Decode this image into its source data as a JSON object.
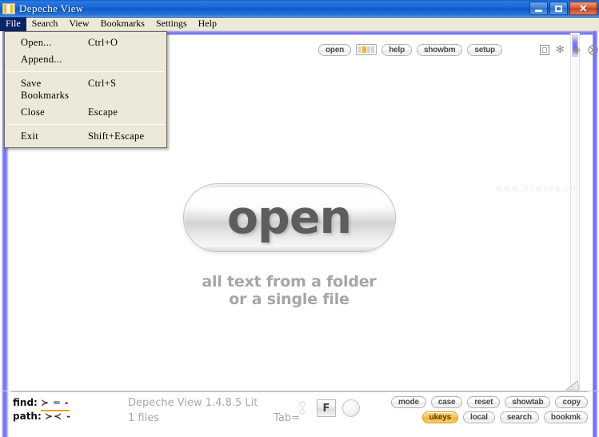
{
  "window": {
    "title": "Depeche View",
    "app_icon": "bars-icon",
    "controls": {
      "minimize": "minimize-icon",
      "maximize": "restore-icon",
      "close": "close-icon"
    }
  },
  "menubar": {
    "items": [
      {
        "label": "File",
        "mnemonic": "F",
        "active": true
      },
      {
        "label": "Search",
        "mnemonic": "S",
        "active": false
      },
      {
        "label": "View",
        "mnemonic": "V",
        "active": false
      },
      {
        "label": "Bookmarks",
        "mnemonic": "B",
        "active": false
      },
      {
        "label": "Settings",
        "mnemonic": "S",
        "active": false
      },
      {
        "label": "Help",
        "mnemonic": "H",
        "active": false
      }
    ]
  },
  "file_menu": {
    "open": true,
    "groups": [
      [
        {
          "label": "Open...",
          "accel": "Ctrl+O"
        },
        {
          "label": "Append...",
          "accel": ""
        }
      ],
      [
        {
          "label": "Save Bookmarks",
          "accel": "Ctrl+S"
        },
        {
          "label": "Close",
          "accel": "Escape"
        }
      ],
      [
        {
          "label": "Exit",
          "accel": "Shift+Escape"
        }
      ]
    ]
  },
  "toolbar": {
    "buttons": [
      {
        "label": "open",
        "name": "toolbar-open-button"
      },
      {
        "label": "help",
        "name": "toolbar-help-button"
      },
      {
        "label": "showbm",
        "name": "toolbar-showbm-button"
      },
      {
        "label": "setup",
        "name": "toolbar-setup-button"
      }
    ],
    "panel_icon": "layout-panels-icon",
    "icons": [
      {
        "name": "window-square-icon",
        "glyph": ""
      },
      {
        "name": "dotted-ring-icon",
        "glyph": "✻"
      },
      {
        "name": "diamond-arrows-icon",
        "glyph": "◇"
      },
      {
        "name": "shuffle-x-icon",
        "glyph": "⨉"
      }
    ]
  },
  "main": {
    "logo_text": "open",
    "subtitle_line1": "all text from a folder",
    "subtitle_line2": "or a single file"
  },
  "statusbar": {
    "find_label": "find:",
    "find_glyphs": "≻ ═ -",
    "path_label": "path:",
    "path_glyphs": "≻≺ -",
    "version": "Depeche View 1.4.8.5 Lit",
    "files": "1 files",
    "tab": "Tab=",
    "widgets": {
      "sort_icon": "sort-chevrons-icon",
      "f_button": "F",
      "circle_icon": "circle-toggle-icon"
    },
    "buttons_row1": [
      {
        "label": "mode",
        "highlight": false
      },
      {
        "label": "case",
        "highlight": false
      },
      {
        "label": "reset",
        "highlight": false
      },
      {
        "label": "showtab",
        "highlight": false
      },
      {
        "label": "copy",
        "highlight": false
      }
    ],
    "buttons_row2": [
      {
        "label": "ukeys",
        "highlight": true
      },
      {
        "label": "local",
        "highlight": false
      },
      {
        "label": "search",
        "highlight": false
      },
      {
        "label": "bookmk",
        "highlight": false
      }
    ]
  },
  "colors": {
    "titlebar_blue": "#1a6ad8",
    "accent_orange": "#f5b324",
    "scrollbar_purple": "#6b6aee",
    "menu_highlight": "#0a246a",
    "text_gray": "#a6a6a6"
  }
}
